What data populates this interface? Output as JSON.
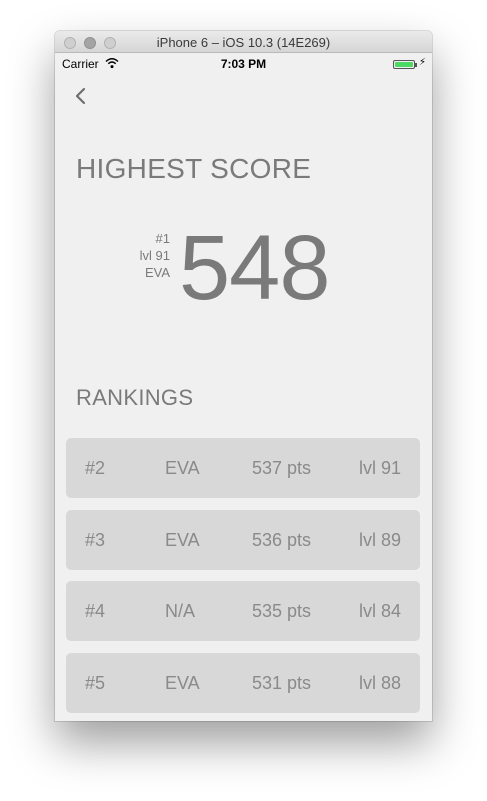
{
  "window": {
    "title": "iPhone 6 – iOS 10.3 (14E269)"
  },
  "status_bar": {
    "carrier": "Carrier",
    "time": "7:03 PM",
    "battery_color": "#4cd964"
  },
  "nav": {
    "back_icon": "chevron-left-icon"
  },
  "highest_score": {
    "title": "HIGHEST SCORE",
    "rank": "#1",
    "level": "lvl 91",
    "name": "EVA",
    "score": "548"
  },
  "rankings": {
    "title": "RANKINGS",
    "rows": [
      {
        "rank": "#2",
        "name": "EVA",
        "points": "537 pts",
        "level": "lvl 91"
      },
      {
        "rank": "#3",
        "name": "EVA",
        "points": "536 pts",
        "level": "lvl 89"
      },
      {
        "rank": "#4",
        "name": "N/A",
        "points": "535 pts",
        "level": "lvl 84"
      },
      {
        "rank": "#5",
        "name": "EVA",
        "points": "531 pts",
        "level": "lvl 88"
      }
    ]
  },
  "colors": {
    "background": "#f0f0f0",
    "row_background": "#d8d8d8",
    "text": "#7a7a7a"
  }
}
